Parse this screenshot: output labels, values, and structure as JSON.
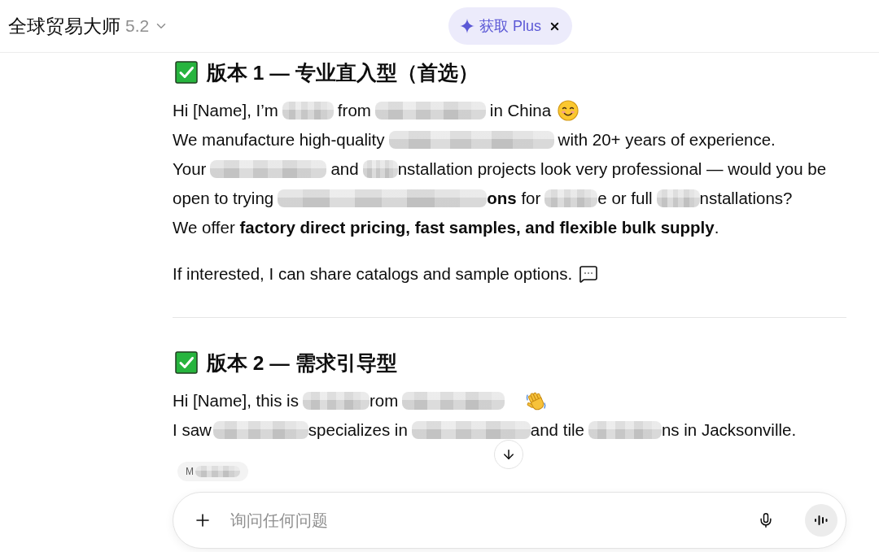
{
  "header": {
    "model_name": "全球贸易大师",
    "version": "5.2",
    "upgrade": {
      "label": "获取 Plus"
    }
  },
  "sections": [
    {
      "heading": "版本 1 — 专业直入型（首选）",
      "paragraphs": [
        {
          "lines": [
            {
              "segments": [
                {
                  "kind": "text",
                  "text": "Hi [Name], I’m"
                },
                {
                  "kind": "blur"
                },
                {
                  "kind": "text",
                  "text": "from"
                },
                {
                  "kind": "blur"
                },
                {
                  "kind": "text",
                  "text": "in China"
                },
                {
                  "kind": "emoji"
                }
              ]
            },
            {
              "segments": [
                {
                  "kind": "text",
                  "text": "We manufacture high-quality"
                },
                {
                  "kind": "blur"
                },
                {
                  "kind": "text",
                  "text": "with 20+ years of experience."
                }
              ]
            },
            {
              "segments": [
                {
                  "kind": "text",
                  "text": "Your"
                },
                {
                  "kind": "blur"
                },
                {
                  "kind": "text",
                  "text": "and"
                },
                {
                  "kind": "blur"
                },
                {
                  "kind": "text",
                  "text": "nstallation projects look very professional — would you be"
                }
              ]
            },
            {
              "segments": [
                {
                  "kind": "text",
                  "text": "open to trying"
                },
                {
                  "kind": "blur"
                },
                {
                  "kind": "text",
                  "text": "**ons** for"
                },
                {
                  "kind": "blur"
                },
                {
                  "kind": "text",
                  "text": "e or full"
                },
                {
                  "kind": "blur"
                },
                {
                  "kind": "text",
                  "text": "nstallations?"
                }
              ]
            },
            {
              "segments": [
                {
                  "kind": "text",
                  "text": "We offer **factory direct pricing, fast samples, and flexible bulk supply**."
                }
              ]
            }
          ]
        },
        {
          "lines": [
            {
              "segments": [
                {
                  "kind": "text",
                  "text": "If interested, I can share catalogs and sample options."
                },
                {
                  "kind": "emoji"
                }
              ]
            }
          ]
        }
      ]
    },
    {
      "heading": "版本 2 — 需求引导型",
      "paragraphs": [
        {
          "lines": [
            {
              "segments": [
                {
                  "kind": "text",
                  "text": "Hi [Name], this is"
                },
                {
                  "kind": "blur"
                },
                {
                  "kind": "text",
                  "text": "rom"
                },
                {
                  "kind": "blur"
                },
                {
                  "kind": "emoji"
                }
              ]
            },
            {
              "segments": [
                {
                  "kind": "text",
                  "text": "I saw"
                },
                {
                  "kind": "blur"
                },
                {
                  "kind": "text",
                  "text": "specializes in"
                },
                {
                  "kind": "blur"
                },
                {
                  "kind": "text",
                  "text": "and tile"
                },
                {
                  "kind": "blur"
                },
                {
                  "kind": "text",
                  "text": "ns in Jacksonville."
                }
              ]
            }
          ]
        }
      ],
      "citation": {
        "text": "M"
      }
    }
  ],
  "composer": {
    "placeholder": "询问任何问题"
  }
}
